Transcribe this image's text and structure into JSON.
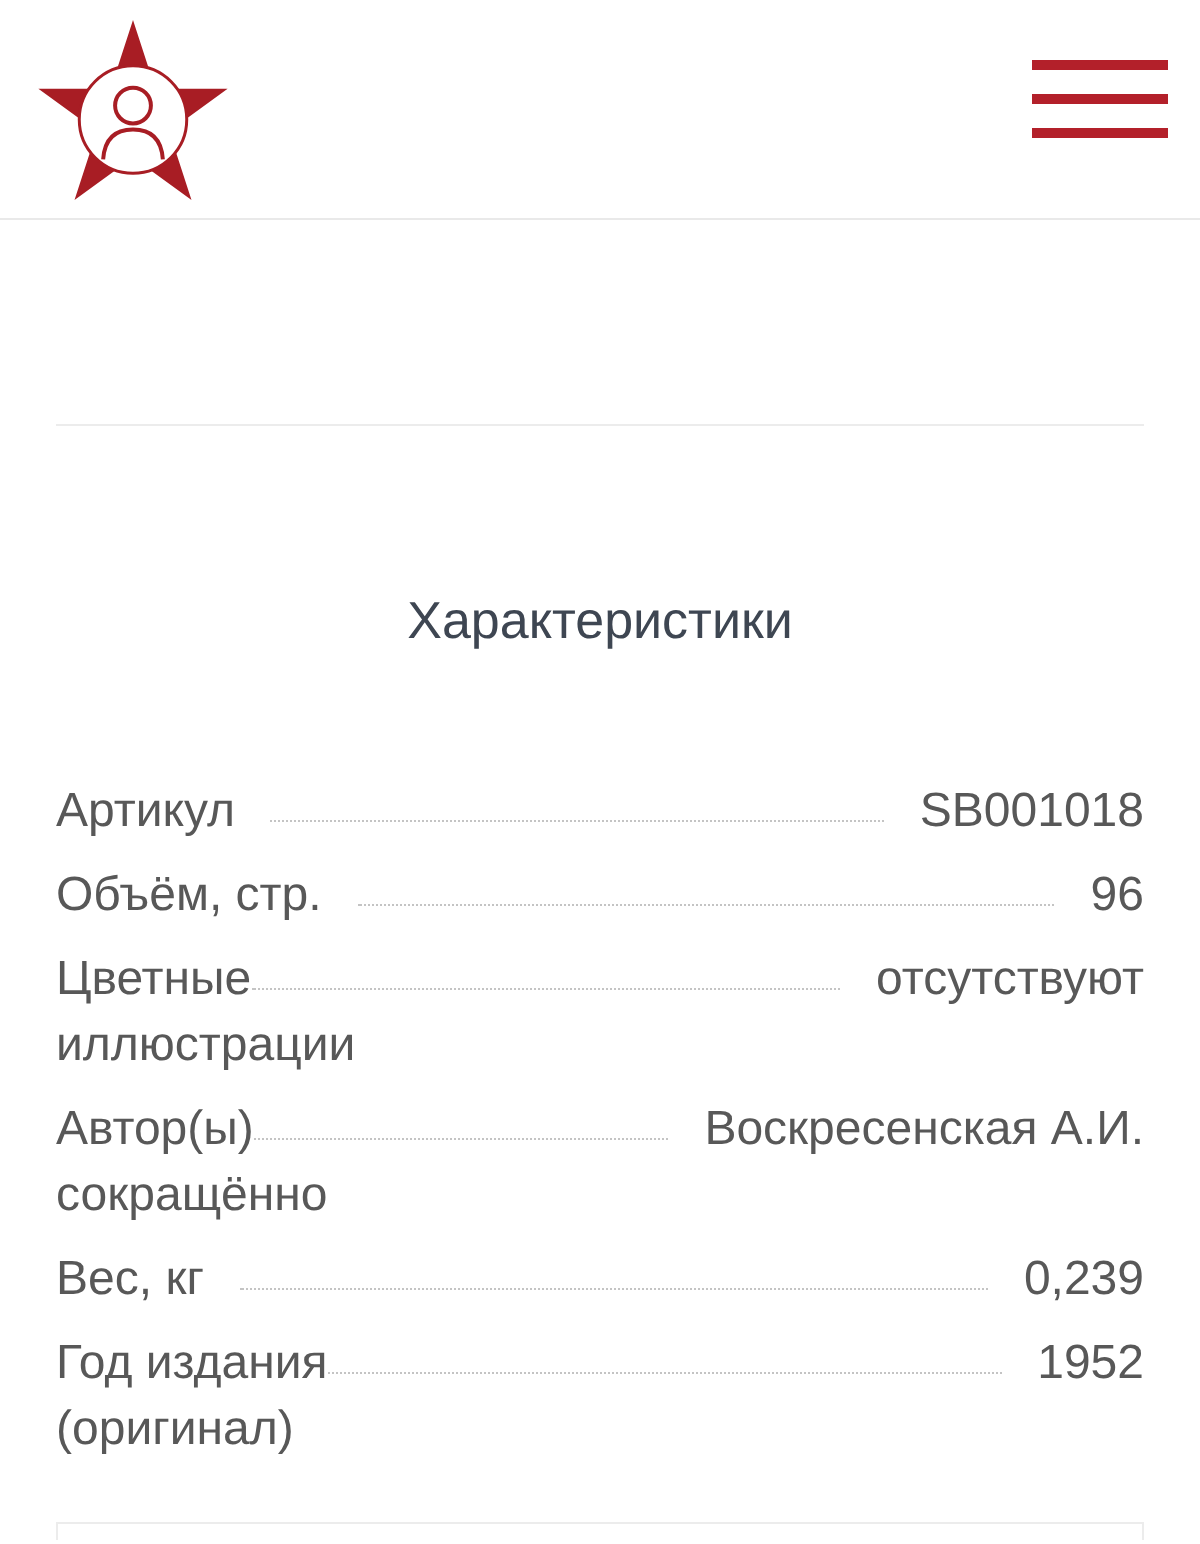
{
  "characteristics": {
    "title": "Характеристики",
    "specs": [
      {
        "label": "Артикул",
        "value": "SB001018"
      },
      {
        "label": "Объём, стр.",
        "value": "96"
      },
      {
        "label": "Цветные иллюстрации",
        "value": "отсутствуют"
      },
      {
        "label": "Автор(ы) сокращённо",
        "value": "Воскресенская А.И."
      },
      {
        "label": "Вес, кг",
        "value": "0,239"
      },
      {
        "label": "Год издания (оригинал)",
        "value": "1952"
      }
    ]
  }
}
